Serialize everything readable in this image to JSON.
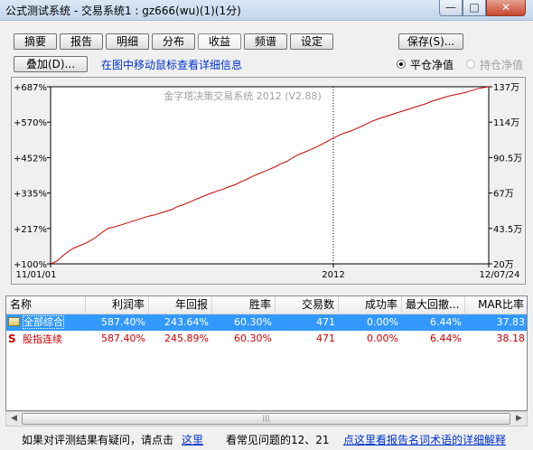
{
  "window": {
    "title": "公式测试系统 - 交易系统1 : gz666(wu)(1)(1分)",
    "minimize_glyph": "—",
    "maximize_glyph": "□",
    "close_glyph": "✕"
  },
  "tabs": [
    {
      "label": "摘要"
    },
    {
      "label": "报告"
    },
    {
      "label": "明细"
    },
    {
      "label": "分布"
    },
    {
      "label": "收益",
      "active": true
    },
    {
      "label": "频谱"
    },
    {
      "label": "设定"
    }
  ],
  "toolbar": {
    "save_label": "保存(S)...",
    "overlay_label": "叠加(D)...",
    "hint_text": "在图中移动鼠标查看详细信息",
    "radio_net": "平仓净值",
    "radio_hold": "持仓净值"
  },
  "chart_data": {
    "type": "line",
    "watermark": "金字塔决策交易系统 2012 (V2.88)",
    "y_left_ticks": [
      "+687%",
      "+570%",
      "+452%",
      "+335%",
      "+217%",
      "+100%"
    ],
    "y_right_ticks": [
      "137万",
      "114万",
      "90.5万",
      "67万",
      "43.5万",
      "20万"
    ],
    "x_ticks": [
      "11/01/01",
      "2012",
      "12/07/24"
    ],
    "ylim": [
      100,
      687
    ],
    "series": [
      {
        "color": "#c80000",
        "values": [
          100,
          108,
          125,
          140,
          152,
          160,
          168,
          178,
          190,
          205,
          218,
          222,
          228,
          234,
          240,
          246,
          252,
          258,
          262,
          268,
          274,
          280,
          290,
          296,
          304,
          312,
          320,
          328,
          335,
          342,
          348,
          356,
          362,
          372,
          380,
          390,
          398,
          406,
          414,
          422,
          432,
          440,
          452,
          462,
          470,
          478,
          486,
          496,
          506,
          516,
          526,
          534,
          540,
          548,
          556,
          566,
          574,
          582,
          588,
          594,
          600,
          606,
          612,
          618,
          624,
          630,
          638,
          644,
          650,
          656,
          660,
          664,
          668,
          674,
          680,
          684,
          687
        ]
      }
    ],
    "line_color": "#c80000",
    "crosshair": true
  },
  "table": {
    "headers": [
      "名称",
      "利润率",
      "年回报",
      "胜率",
      "交易数",
      "成功率",
      "最大回撤...",
      "MAR比率"
    ],
    "rows": [
      {
        "icon": "folder-icon",
        "name": "全部综合",
        "cells": [
          "587.40%",
          "243.64%",
          "60.30%",
          "471",
          "0.00%",
          "6.44%",
          "37.83"
        ],
        "selected": true
      },
      {
        "icon": "S",
        "name": "股指连续",
        "cells": [
          "587.40%",
          "245.89%",
          "60.30%",
          "471",
          "0.00%",
          "6.44%",
          "38.18"
        ],
        "selected": false
      }
    ],
    "scroll_left": "◀",
    "scroll_right": "▶",
    "scroll_grip": "|||"
  },
  "footer": {
    "question_text": "如果对评测结果有疑问，请点击",
    "here_link": "这里",
    "faq_text": "看常见问题的12、21",
    "glossary_link": "点这里看报告名词术语的详细解释"
  }
}
